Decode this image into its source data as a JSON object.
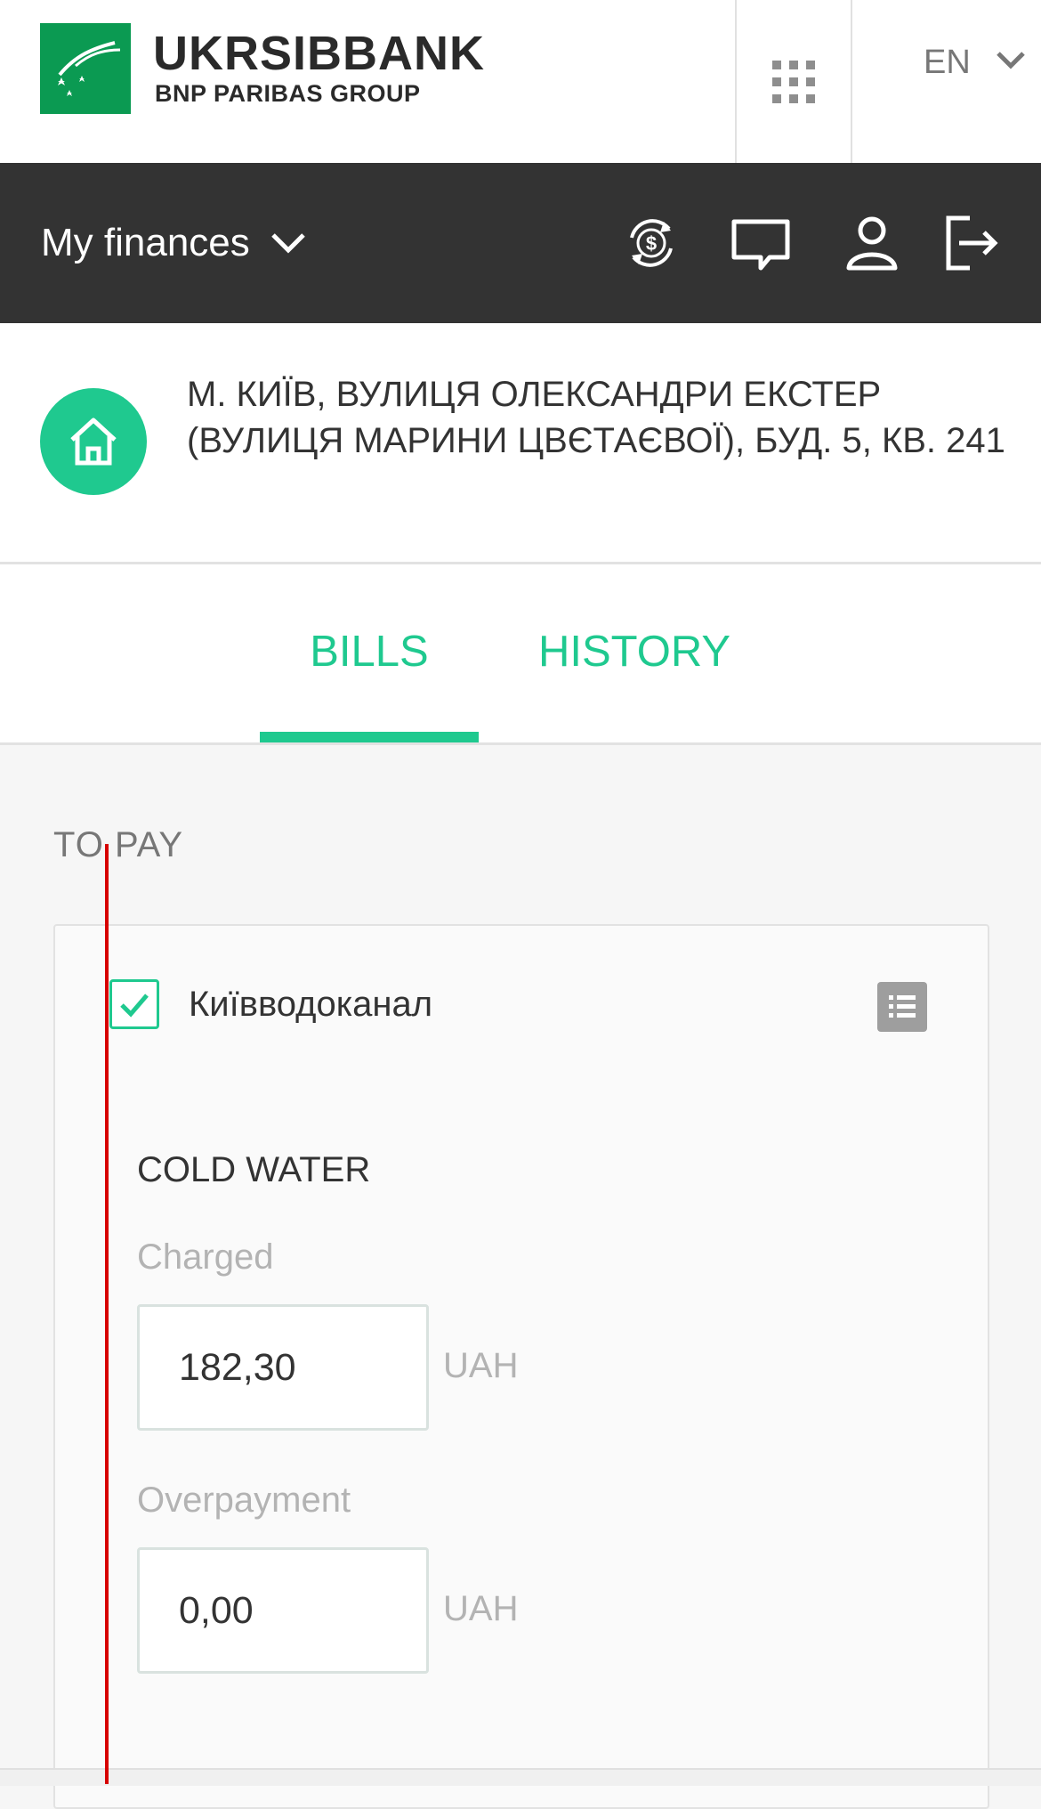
{
  "header": {
    "brand_name": "UKRSIBBANK",
    "brand_group": "BNP PARIBAS GROUP",
    "language": "EN",
    "brand_color": "#0b9a52"
  },
  "navbar": {
    "menu_label": "My finances",
    "icons": [
      "currency-exchange-icon",
      "chat-icon",
      "profile-icon",
      "logout-icon"
    ]
  },
  "address": {
    "text": "М. КИЇВ, ВУЛИЦЯ ОЛЕКСАНДРИ ЕКСТЕР (ВУЛИЦЯ МАРИНИ ЦВЄТАЄВОЇ), БУД. 5, КВ. 241"
  },
  "tabs": [
    {
      "label": "BILLS",
      "active": true
    },
    {
      "label": "HISTORY",
      "active": false
    }
  ],
  "content": {
    "section_title": "TO PAY",
    "bill": {
      "provider": "Київводоканал",
      "checked": true,
      "service": "COLD WATER",
      "charged_label": "Charged",
      "charged_value": "182,30",
      "overpayment_label": "Overpayment",
      "overpayment_value": "0,00",
      "currency": "UAH"
    }
  },
  "colors": {
    "accent": "#1fc98f",
    "nav_bg": "#333333",
    "guide_line": "#d70000"
  }
}
